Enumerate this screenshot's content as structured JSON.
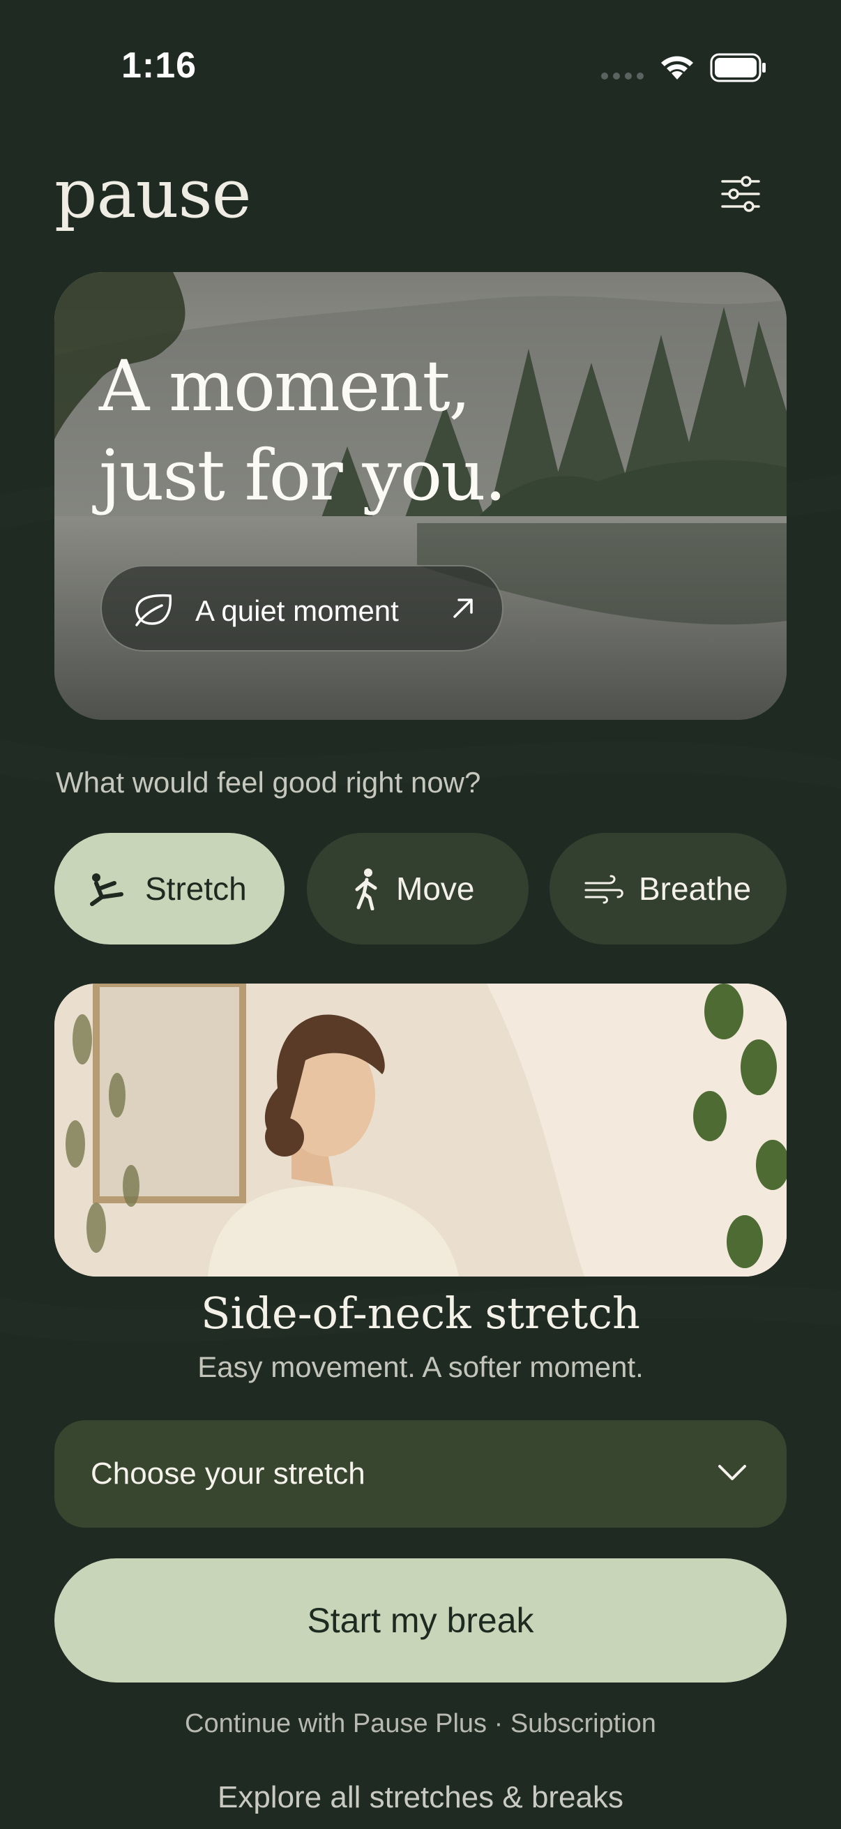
{
  "status_bar": {
    "time": "1:16"
  },
  "header": {
    "brand": "pause",
    "filter_icon": "sliders-icon"
  },
  "hero": {
    "title_line1": "A moment,",
    "title_line2": "just for you.",
    "button_label": "A quiet moment",
    "button_icon": "leaf-icon",
    "arrow_icon": "arrow-up-right-icon"
  },
  "prompt": "What would feel good right now?",
  "categories": [
    {
      "label": "Stretch",
      "icon": "stretch-icon",
      "active": true
    },
    {
      "label": "Move",
      "icon": "walk-icon",
      "active": false
    },
    {
      "label": "Breathe",
      "icon": "wind-icon",
      "active": false
    }
  ],
  "card": {
    "title": "Side-of-neck stretch",
    "subtitle": "Easy movement. A softer moment."
  },
  "select": {
    "label": "Choose your stretch"
  },
  "start_button": "Start my break",
  "plus_link": "Continue with Pause Plus · Subscription",
  "explore_link": "Explore all stretches & breaks",
  "colors": {
    "background": "#1f2a22",
    "accent": "#c8d5b9",
    "pill_inactive": "#33402f",
    "select_bg": "#38462f"
  }
}
